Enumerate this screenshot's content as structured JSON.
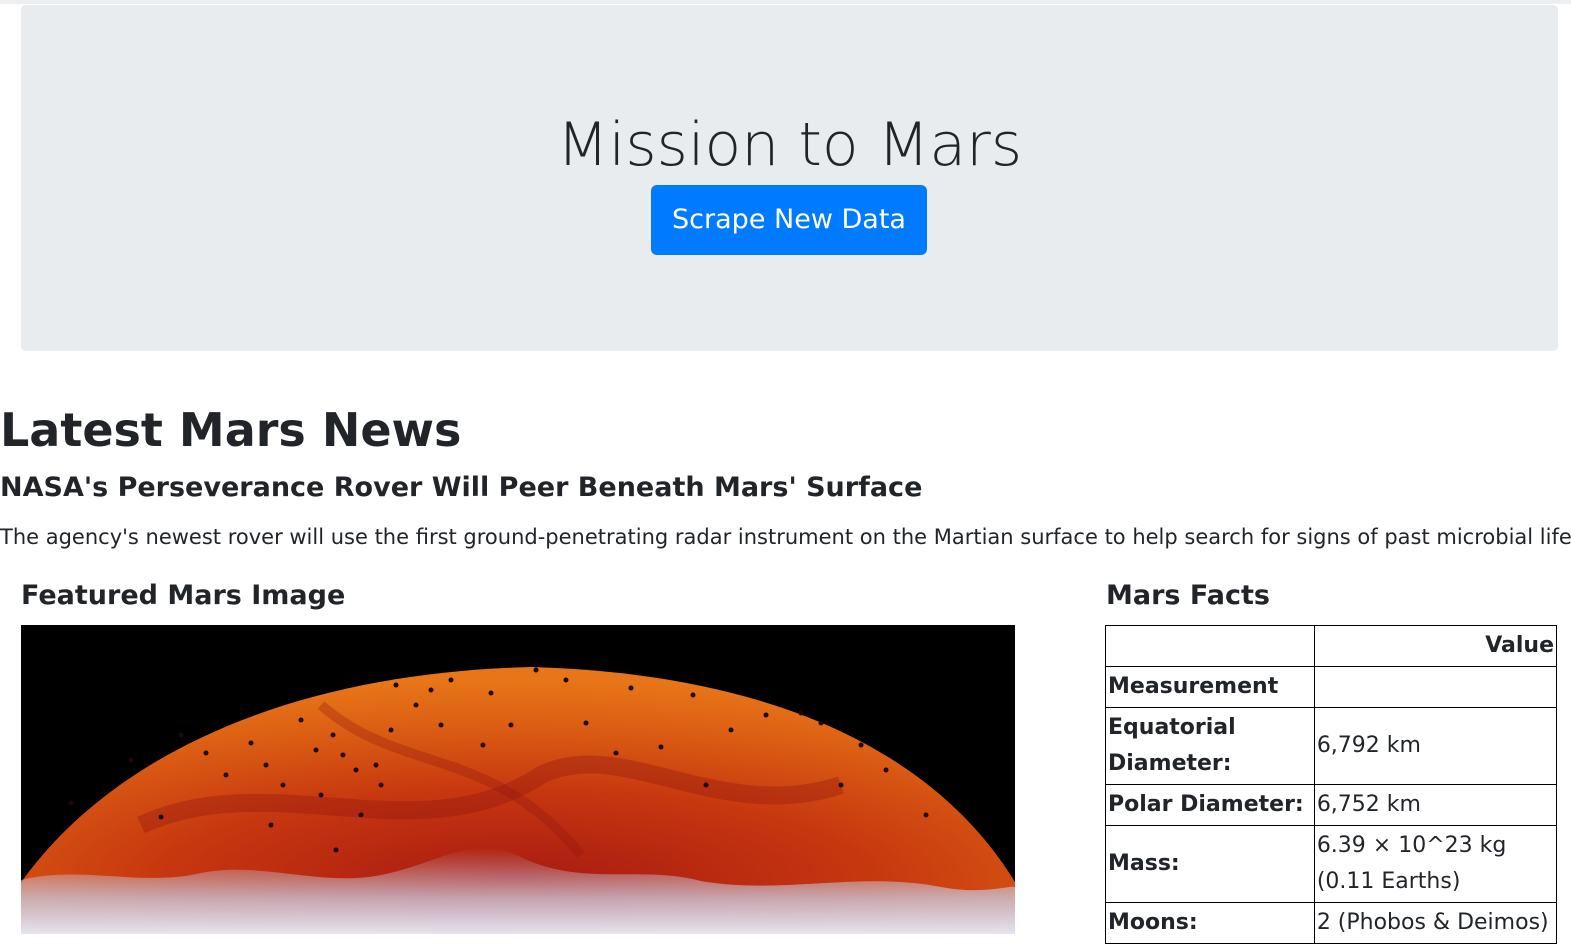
{
  "jumbotron": {
    "title": "Mission to Mars",
    "button_label": "Scrape New Data"
  },
  "news": {
    "heading": "Latest Mars News",
    "title": "NASA's Perseverance Rover Will Peer Beneath Mars' Surface",
    "paragraph": "The agency's newest rover will use the first ground-penetrating radar instrument on the Martian surface to help search for signs of past microbial life."
  },
  "featured": {
    "heading": "Featured Mars Image"
  },
  "facts": {
    "heading": "Mars Facts",
    "header_value": "Value",
    "index_label": "Measurement",
    "rows": [
      {
        "label": "Equatorial Diameter:",
        "value": "6,792 km"
      },
      {
        "label": "Polar Diameter:",
        "value": "6,752 km"
      },
      {
        "label": "Mass:",
        "value": "6.39 × 10^23 kg (0.11 Earths)"
      },
      {
        "label": "Moons:",
        "value": "2 (Phobos & Deimos)"
      }
    ]
  },
  "colors": {
    "primary_button": "#007bff",
    "jumbotron_bg": "#e9ecef",
    "text": "#212529"
  }
}
